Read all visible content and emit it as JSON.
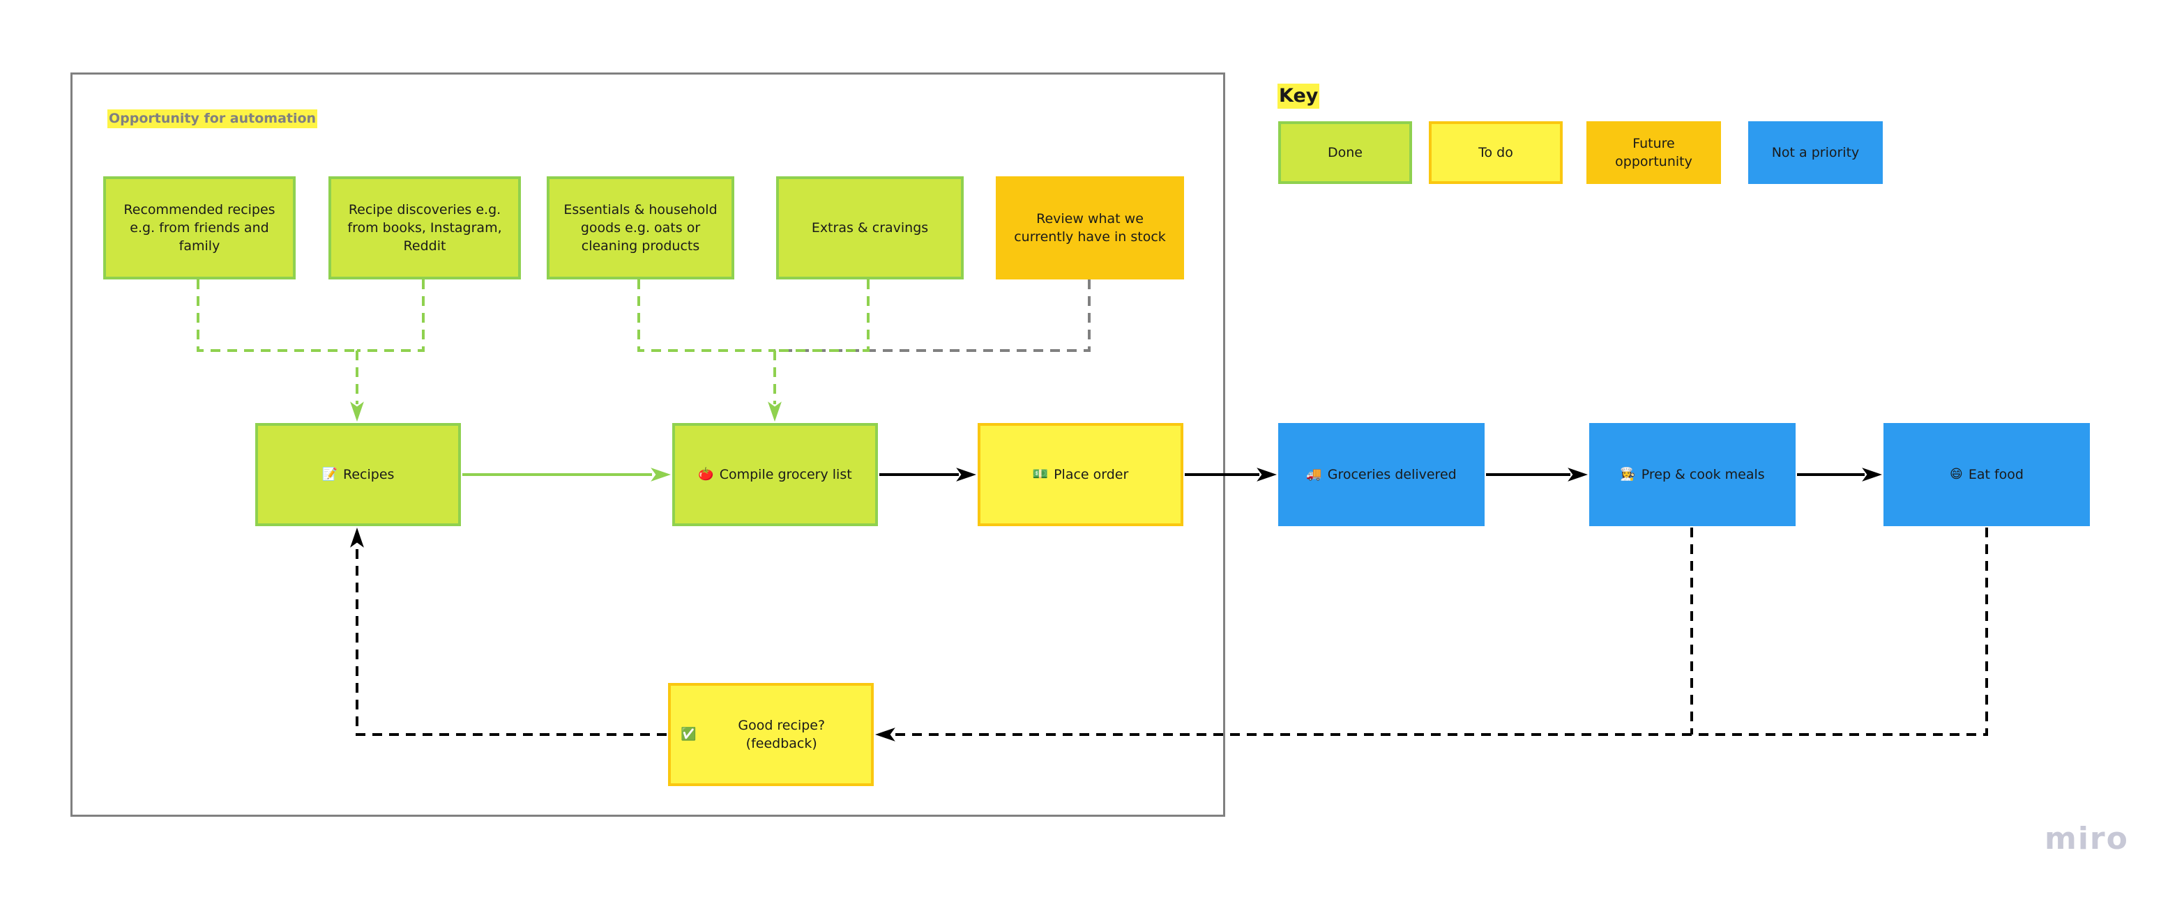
{
  "frame": {
    "label": "Opportunity for automation"
  },
  "key": {
    "title": "Key",
    "items": [
      {
        "label": "Done",
        "status": "done"
      },
      {
        "label": "To do",
        "status": "todo"
      },
      {
        "label": "Future opportunity",
        "status": "future"
      },
      {
        "label": "Not a priority",
        "status": "notpri"
      }
    ]
  },
  "colors": {
    "done_fill": "#cee741",
    "done_border": "#8fd14f",
    "todo_fill": "#fef445",
    "todo_border": "#fac710",
    "future_fill": "#fac710",
    "not_priority_fill": "#2d9bf0",
    "frame_border": "#808080"
  },
  "inputs": [
    {
      "text": "Recommended recipes e.g. from friends and family",
      "status": "done"
    },
    {
      "text": "Recipe discoveries e.g. from books, Instagram, Reddit",
      "status": "done"
    },
    {
      "text": "Essentials & household goods e.g. oats or cleaning products",
      "status": "done"
    },
    {
      "text": "Extras & cravings",
      "status": "done"
    },
    {
      "text": "Review what we currently have in stock",
      "status": "future"
    }
  ],
  "flow": [
    {
      "emoji": "📝",
      "icon": "memo-icon",
      "text": "Recipes",
      "status": "done"
    },
    {
      "emoji": "🍅",
      "icon": "tomato-icon",
      "text": "Compile grocery list",
      "status": "done"
    },
    {
      "emoji": "💵",
      "icon": "banknote-icon",
      "text": "Place order",
      "status": "todo"
    },
    {
      "emoji": "🚚",
      "icon": "delivery-truck-icon",
      "text": "Groceries delivered",
      "status": "notpri"
    },
    {
      "emoji": "👩‍🍳",
      "icon": "cook-icon",
      "text": "Prep & cook meals",
      "status": "notpri"
    },
    {
      "emoji": "😄",
      "icon": "grinning-face-icon",
      "text": "Eat food",
      "status": "notpri"
    }
  ],
  "feedback": {
    "emoji": "✅",
    "icon": "check-mark-icon",
    "text": "Good recipe? (feedback)",
    "status": "todo"
  },
  "branding": {
    "logo": "miro"
  }
}
